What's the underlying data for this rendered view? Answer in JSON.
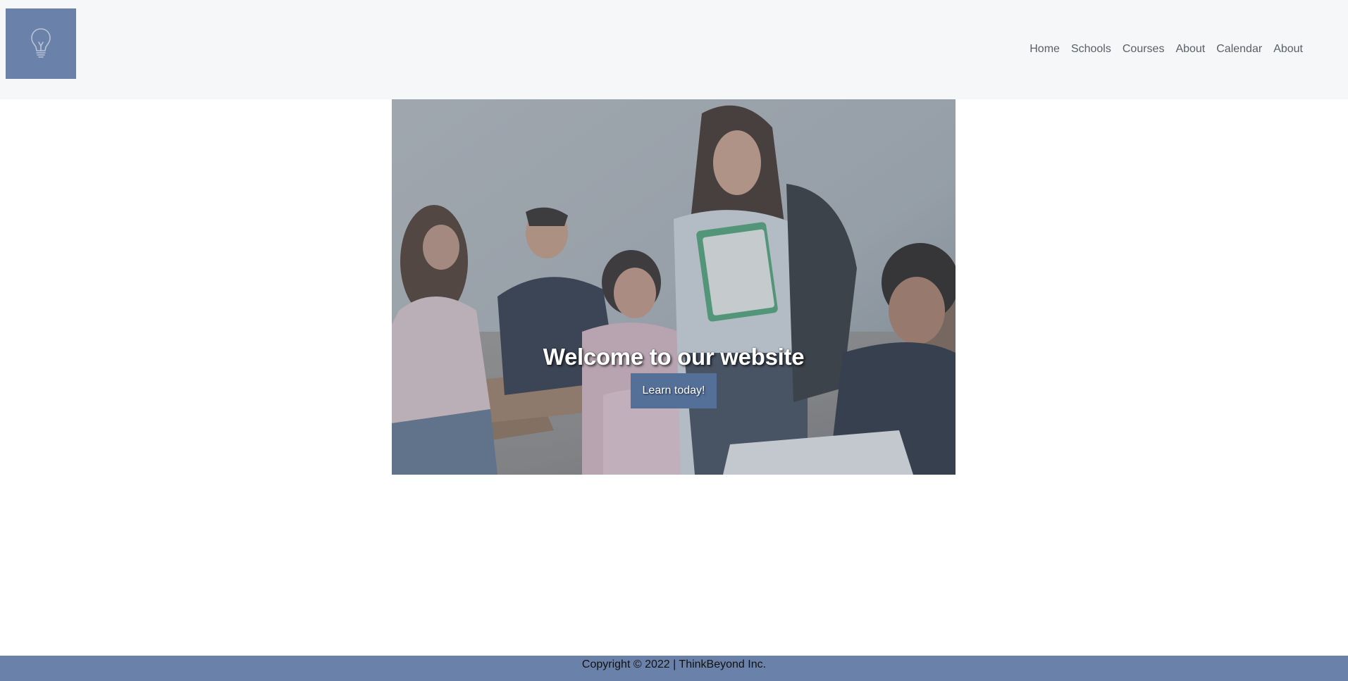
{
  "header": {
    "logo_icon": "lightbulb-icon",
    "nav": [
      {
        "label": "Home"
      },
      {
        "label": "Schools"
      },
      {
        "label": "Courses"
      },
      {
        "label": "About"
      },
      {
        "label": "Calendar"
      },
      {
        "label": "About"
      }
    ]
  },
  "hero": {
    "title": "Welcome to our website",
    "button_label": "Learn today!",
    "image": "classroom-students-photo"
  },
  "footer": {
    "copyright": "Copyright © 2022 | ThinkBeyond Inc."
  },
  "colors": {
    "header_bg": "#f6f7f9",
    "accent": "#6a81a9",
    "button_bg": "#546f98",
    "nav_text": "#5a5f66"
  }
}
